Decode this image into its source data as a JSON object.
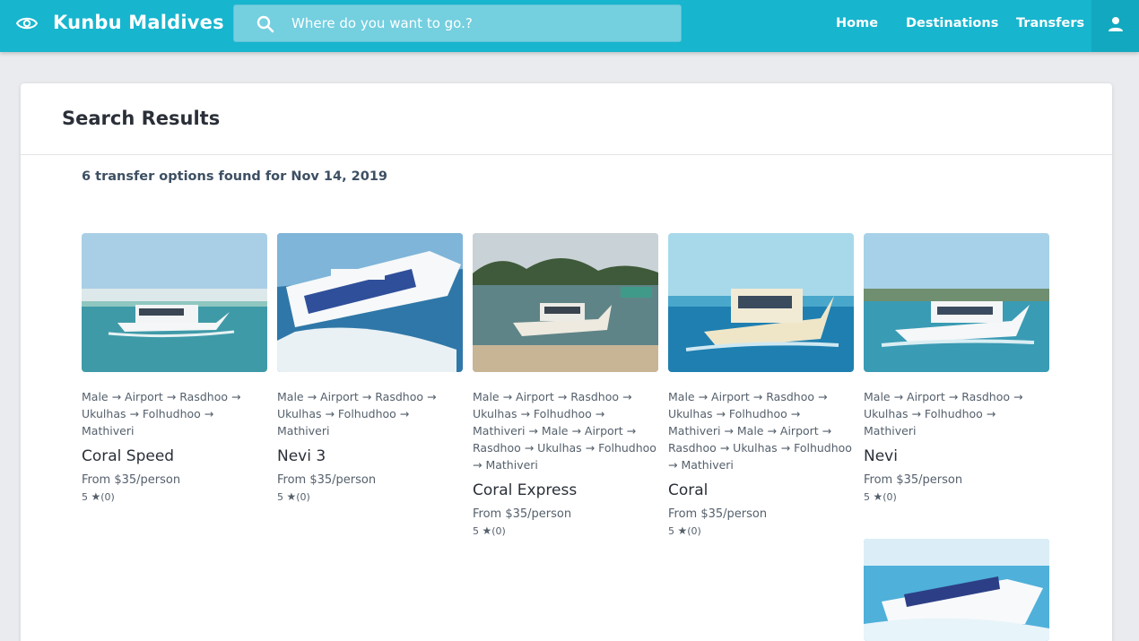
{
  "header": {
    "brand": "Kunbu Maldives",
    "logo_icon": "eye-icon",
    "search_placeholder": "Where do you want to go.?",
    "search_icon": "search-icon",
    "nav": [
      "Home",
      "Destinations",
      "Transfers"
    ],
    "user_icon": "person-icon",
    "colors": {
      "bar": "#17b5ce",
      "search_bg": "#74cfdf",
      "user_bg": "#12a8c0"
    }
  },
  "page": {
    "title": "Search Results",
    "summary": "6 transfer options found for Nov 14, 2019"
  },
  "results": [
    {
      "name": "Coral Speed",
      "route": [
        "Male",
        "Airport",
        "Rasdhoo",
        "Ukulhas",
        "Folhudhoo",
        "Mathiveri"
      ],
      "price": "From $35/person",
      "rating": "5",
      "reviews": "(0)"
    },
    {
      "name": "Nevi 3",
      "route": [
        "Male",
        "Airport",
        "Rasdhoo",
        "Ukulhas",
        "Folhudhoo",
        "Mathiveri"
      ],
      "price": "From $35/person",
      "rating": "5",
      "reviews": "(0)"
    },
    {
      "name": "Coral Express",
      "route": [
        "Male",
        "Airport",
        "Rasdhoo",
        "Ukulhas",
        "Folhudhoo",
        "Mathiveri",
        "Male",
        "Airport",
        "Rasdhoo",
        "Ukulhas",
        "Folhudhoo",
        "Mathiveri"
      ],
      "price": "From $35/person",
      "rating": "5",
      "reviews": "(0)"
    },
    {
      "name": "Coral",
      "route": [
        "Male",
        "Airport",
        "Rasdhoo",
        "Ukulhas",
        "Folhudhoo",
        "Mathiveri",
        "Male",
        "Airport",
        "Rasdhoo",
        "Ukulhas",
        "Folhudhoo",
        "Mathiveri"
      ],
      "price": "From $35/person",
      "rating": "5",
      "reviews": "(0)"
    },
    {
      "name": "Nevi",
      "route": [
        "Male",
        "Airport",
        "Rasdhoo",
        "Ukulhas",
        "Folhudhoo",
        "Mathiveri"
      ],
      "price": "From $35/person",
      "rating": "5",
      "reviews": "(0)"
    }
  ],
  "arrow_glyph": "→",
  "star_icon": "star-icon"
}
